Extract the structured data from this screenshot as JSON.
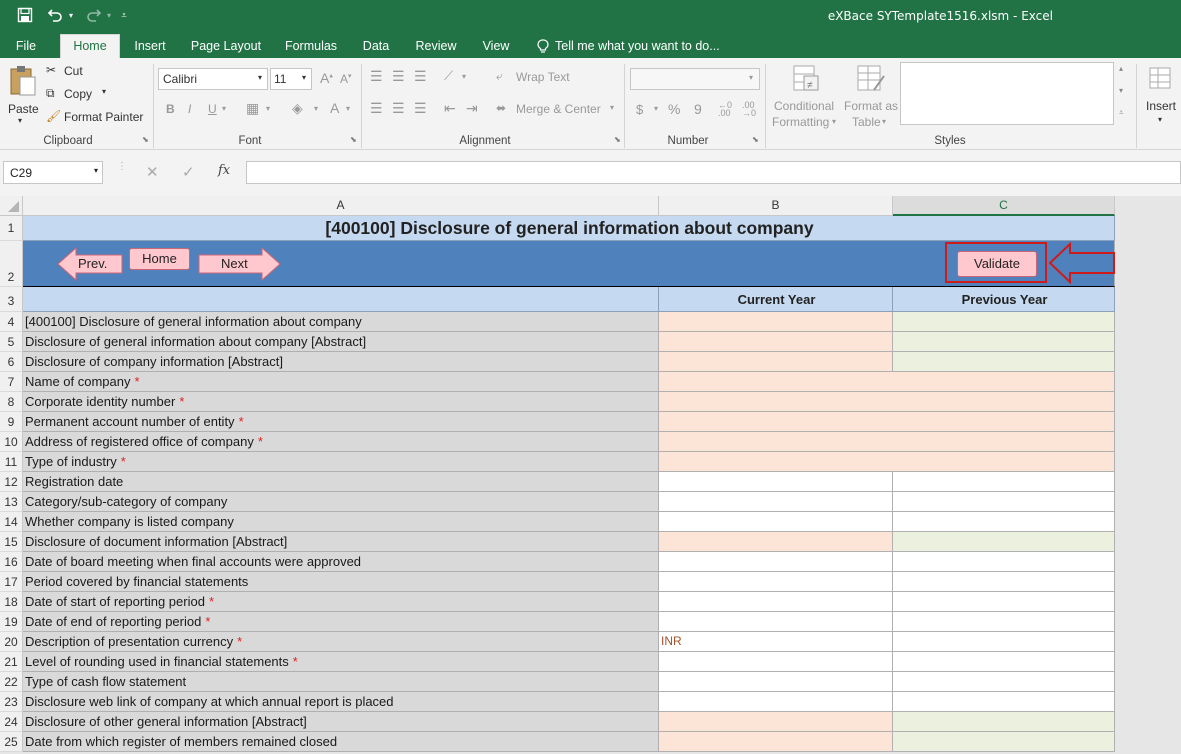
{
  "window": {
    "title": "eXBace SYTemplate1516.xlsm - Excel"
  },
  "tabs": [
    "File",
    "Home",
    "Insert",
    "Page Layout",
    "Formulas",
    "Data",
    "Review",
    "View"
  ],
  "tell_me": "Tell me what you want to do...",
  "ribbon": {
    "clipboard": {
      "paste": "Paste",
      "cut": "Cut",
      "copy": "Copy",
      "format_painter": "Format Painter",
      "label": "Clipboard"
    },
    "font": {
      "name": "Calibri",
      "size": "11",
      "bold": "B",
      "italic": "I",
      "underline": "U",
      "label": "Font"
    },
    "alignment": {
      "wrap_text": "Wrap Text",
      "merge_center": "Merge & Center",
      "label": "Alignment"
    },
    "number": {
      "format": "",
      "label": "Number",
      "currency": "$",
      "percent": "%",
      "comma": "9"
    },
    "styles": {
      "conditional": "Conditional",
      "formatting": "Formatting",
      "format_as": "Format as",
      "table": "Table",
      "label": "Styles"
    },
    "cells": {
      "insert": "Insert"
    }
  },
  "formula_bar": {
    "name_box": "C29",
    "formula": ""
  },
  "columns": [
    "A",
    "B",
    "C"
  ],
  "sheet": {
    "title": "[400100] Disclosure of general information about company",
    "nav": {
      "prev": "Prev.",
      "home": "Home",
      "next": "Next",
      "validate": "Validate"
    },
    "current_year": "Current Year",
    "previous_year": "Previous Year",
    "rows": [
      {
        "num": "4",
        "label": "[400100] Disclosure of general information about company",
        "req": "",
        "b": "",
        "c": ""
      },
      {
        "num": "5",
        "label": "Disclosure of general information about company [Abstract]",
        "req": "",
        "b": "",
        "c": ""
      },
      {
        "num": "6",
        "label": "Disclosure of company information [Abstract]",
        "req": "",
        "b": "",
        "c": ""
      },
      {
        "num": "7",
        "label": "Name of company",
        "req": "*",
        "b": "",
        "c": ""
      },
      {
        "num": "8",
        "label": "Corporate identity number",
        "req": "*",
        "b": "",
        "c": ""
      },
      {
        "num": "9",
        "label": "Permanent account number of entity",
        "req": "*",
        "b": "",
        "c": ""
      },
      {
        "num": "10",
        "label": "Address of registered office of company",
        "req": "*",
        "b": "",
        "c": ""
      },
      {
        "num": "11",
        "label": "Type of industry",
        "req": "*",
        "b": "",
        "c": ""
      },
      {
        "num": "12",
        "label": "Registration date",
        "req": "",
        "b": "",
        "c": ""
      },
      {
        "num": "13",
        "label": "Category/sub-category of company",
        "req": "",
        "b": "",
        "c": ""
      },
      {
        "num": "14",
        "label": "Whether company is listed company",
        "req": "",
        "b": "",
        "c": ""
      },
      {
        "num": "15",
        "label": "Disclosure of document information [Abstract]",
        "req": "",
        "b": "",
        "c": ""
      },
      {
        "num": "16",
        "label": "Date of board meeting when final accounts were approved",
        "req": "",
        "b": "",
        "c": ""
      },
      {
        "num": "17",
        "label": "Period covered by financial statements",
        "req": "",
        "b": "",
        "c": ""
      },
      {
        "num": "18",
        "label": "Date of start of reporting period",
        "req": "*",
        "b": "",
        "c": ""
      },
      {
        "num": "19",
        "label": "Date of end of reporting period",
        "req": "*",
        "b": "",
        "c": ""
      },
      {
        "num": "20",
        "label": "Description of presentation currency",
        "req": "*",
        "b": "INR",
        "c": ""
      },
      {
        "num": "21",
        "label": "Level of rounding used in financial statements",
        "req": "*",
        "b": "",
        "c": ""
      },
      {
        "num": "22",
        "label": "Type of cash flow statement",
        "req": "",
        "b": "",
        "c": ""
      },
      {
        "num": "23",
        "label": "Disclosure web link of company at which annual report is placed",
        "req": "",
        "b": "",
        "c": ""
      },
      {
        "num": "24",
        "label": "Disclosure of other general information [Abstract]",
        "req": "",
        "b": "",
        "c": ""
      },
      {
        "num": "25",
        "label": "Date from which register of members remained closed",
        "req": "",
        "b": "",
        "c": ""
      }
    ]
  }
}
